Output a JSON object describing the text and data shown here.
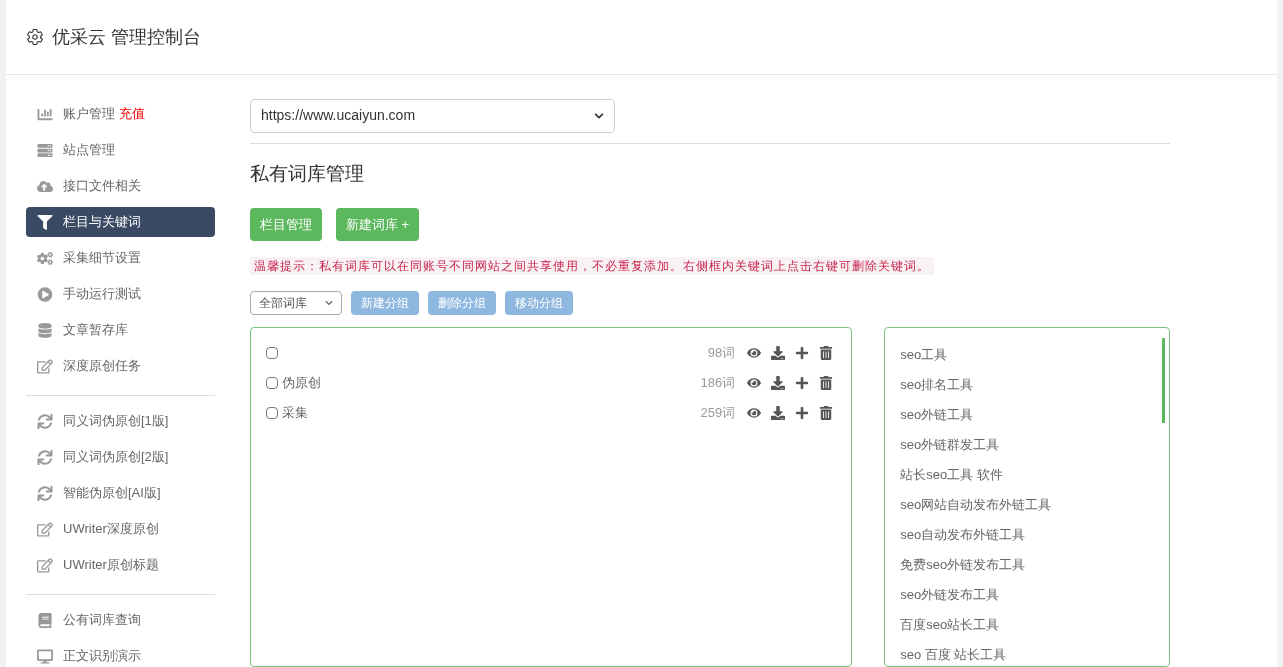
{
  "header": {
    "title": "优采云 管理控制台"
  },
  "sidebar": {
    "groups": [
      {
        "items": [
          {
            "label": "账户管理",
            "badge": "充值",
            "selected": false
          },
          {
            "label": "站点管理",
            "selected": false
          },
          {
            "label": "接口文件相关",
            "selected": false
          },
          {
            "label": "栏目与关键词",
            "selected": true
          },
          {
            "label": "采集细节设置",
            "selected": false
          },
          {
            "label": "手动运行测试",
            "selected": false
          },
          {
            "label": "文章暂存库",
            "selected": false
          },
          {
            "label": "深度原创任务",
            "selected": false
          }
        ]
      },
      {
        "items": [
          {
            "label": "同义词伪原创[1版]",
            "selected": false
          },
          {
            "label": "同义词伪原创[2版]",
            "selected": false
          },
          {
            "label": "智能伪原创[AI版]",
            "selected": false
          },
          {
            "label": "UWriter深度原创",
            "selected": false
          },
          {
            "label": "UWriter原创标题",
            "selected": false
          }
        ]
      },
      {
        "items": [
          {
            "label": "公有词库查询",
            "selected": false
          },
          {
            "label": "正文识别演示",
            "selected": false
          }
        ]
      }
    ]
  },
  "site_select": {
    "value": "https://www.ucaiyun.com"
  },
  "section_title": "私有词库管理",
  "action_buttons": [
    "栏目管理",
    "新建词库 +"
  ],
  "tip": "温馨提示：私有词库可以在同账号不同网站之间共享使用，不必重复添加。右侧框内关键词上点击右键可删除关键词。",
  "group_select": {
    "value": "全部词库"
  },
  "group_buttons": [
    "新建分组",
    "删除分组",
    "移动分组"
  ],
  "libraries": [
    {
      "count": "98词",
      "checked": false
    },
    {
      "name": "伪原创",
      "count": "186词",
      "checked": false
    },
    {
      "name": "采集",
      "count": "259词",
      "checked": false
    }
  ],
  "keywords": [
    "seo工具",
    "seo排名工具",
    "seo外链工具",
    "seo外链群发工具",
    "站长seo工具 软件",
    "seo网站自动发布外链工具",
    "seo自动发布外链工具",
    "免费seo外链发布工具",
    "seo外链发布工具",
    "百度seo站长工具",
    "seo 百度 站长工具"
  ]
}
